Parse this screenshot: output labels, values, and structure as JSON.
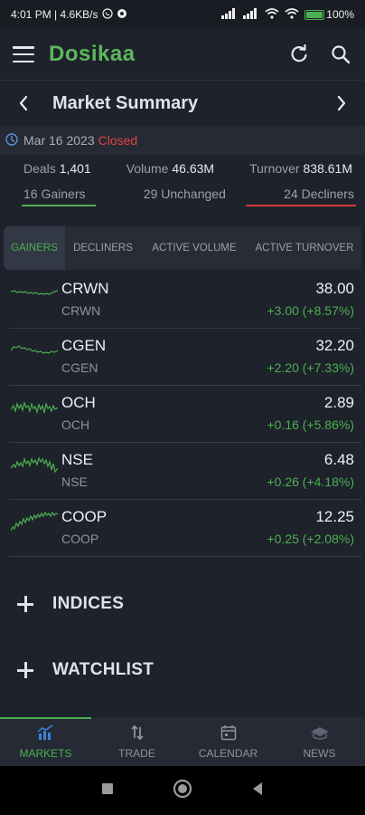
{
  "status_bar": {
    "time_speed": "4:01 PM | 4.6KB/s",
    "battery": "100",
    "battery_percent_suffix": "%"
  },
  "app": {
    "title": "Dosikaa",
    "brand_color": "#5cb85c"
  },
  "summary": {
    "title": "Market Summary",
    "date": "Mar 16 2023",
    "status": "Closed",
    "deals_label": "Deals",
    "deals_value": "1,401",
    "volume_label": "Volume",
    "volume_value": "46.63M",
    "turnover_label": "Turnover",
    "turnover_value": "838.61M",
    "gainers": "16 Gainers",
    "unchanged": "29 Unchanged",
    "decliners": "24 Decliners"
  },
  "tabs": [
    {
      "label": "GAINERS",
      "active": true
    },
    {
      "label": "DECLINERS",
      "active": false
    },
    {
      "label": "ACTIVE VOLUME",
      "active": false
    },
    {
      "label": "ACTIVE TURNOVER",
      "active": false
    }
  ],
  "stocks": [
    {
      "symbol": "CRWN",
      "name": "CRWN",
      "price": "38.00",
      "change": "+3.00 (+8.57%)"
    },
    {
      "symbol": "CGEN",
      "name": "CGEN",
      "price": "32.20",
      "change": "+2.20 (+7.33%)"
    },
    {
      "symbol": "OCH",
      "name": "OCH",
      "price": "2.89",
      "change": "+0.16 (+5.86%)"
    },
    {
      "symbol": "NSE",
      "name": "NSE",
      "price": "6.48",
      "change": "+0.26 (+4.18%)"
    },
    {
      "symbol": "COOP",
      "name": "COOP",
      "price": "12.25",
      "change": "+0.25 (+2.08%)"
    }
  ],
  "sections": {
    "indices": "INDICES",
    "watchlist": "WATCHLIST"
  },
  "bottom_nav": [
    {
      "label": "MARKETS",
      "icon": "markets-chart-icon",
      "active": true
    },
    {
      "label": "TRADE",
      "icon": "trade-arrows-icon",
      "active": false
    },
    {
      "label": "CALENDAR",
      "icon": "calendar-icon",
      "active": false
    },
    {
      "label": "NEWS",
      "icon": "news-icon",
      "active": false
    }
  ],
  "colors": {
    "positive": "#4caf50",
    "negative": "#e0443e",
    "background": "#1e222b"
  }
}
